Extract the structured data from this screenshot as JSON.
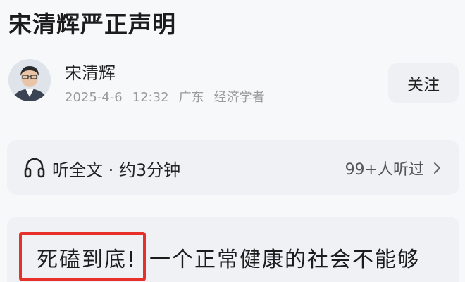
{
  "article": {
    "title": "宋清辉严正声明",
    "first_line_highlight": "死磕到底!",
    "first_line_rest": "一个正常健康的社会不能够"
  },
  "author": {
    "name": "宋清辉",
    "date": "2025-4-6",
    "time": "12:32",
    "location": "广东",
    "role": "经济学者",
    "avatar_icon": "person-portrait"
  },
  "follow": {
    "label": "关注"
  },
  "listen": {
    "icon": "headphone-icon",
    "label": "听全文 · 约3分钟",
    "count": "99+人听过"
  },
  "colors": {
    "background": "#f7f8fa",
    "card": "#eff1f5",
    "highlight_border": "#e8302a",
    "meta_text": "#9a9a9a"
  }
}
